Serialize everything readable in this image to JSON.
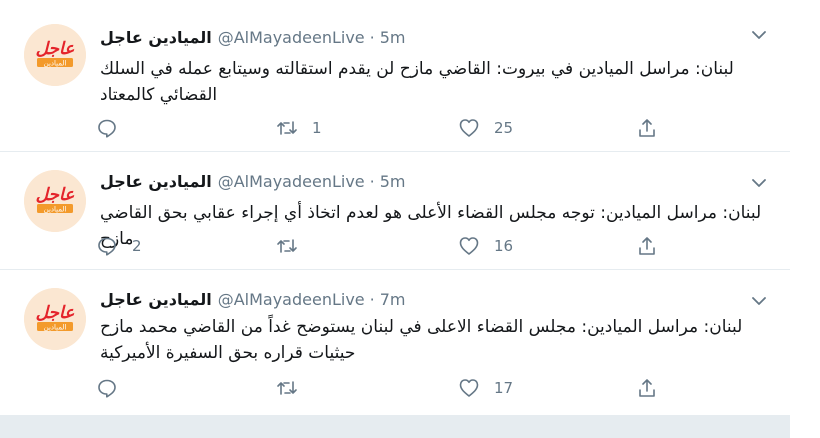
{
  "tweets": [
    {
      "name": "الميادين عاجل",
      "handle": "@AlMayadeenLive",
      "separator": "·",
      "time": "5m",
      "text": "لبنان: مراسل الميادين في بيروت: القاضي مازح لن يقدم استقالته وسيتابع عمله في السلك القضائي كالمعتاد",
      "replies": "",
      "retweets": "1",
      "likes": "25"
    },
    {
      "name": "الميادين عاجل",
      "handle": "@AlMayadeenLive",
      "separator": "·",
      "time": "5m",
      "text": "لبنان: مراسل الميادين: توجه مجلس القضاء الأعلى هو لعدم اتخاذ أي إجراء عقابي بحق القاضي مازح",
      "replies": "2",
      "retweets": "",
      "likes": "16"
    },
    {
      "name": "الميادين عاجل",
      "handle": "@AlMayadeenLive",
      "separator": "·",
      "time": "7m",
      "text": "لبنان: مراسل الميادين: مجلس القضاء الاعلى في لبنان يستوضح غداً من القاضي محمد مازح حيثيات قراره بحق السفيرة الأميركية",
      "replies": "",
      "retweets": "",
      "likes": "17"
    }
  ],
  "avatar": {
    "logo_text": "عاجل",
    "sub_text": "الميادين",
    "red": "#e4242b",
    "orange": "#f39a2b",
    "bg": "#fbe7d2"
  },
  "colors": {
    "text": "#14171a",
    "muted": "#657786",
    "border": "#e6ecf0"
  },
  "icons": [
    "reply-icon",
    "retweet-icon",
    "like-icon",
    "share-icon",
    "chevron-down-icon"
  ]
}
